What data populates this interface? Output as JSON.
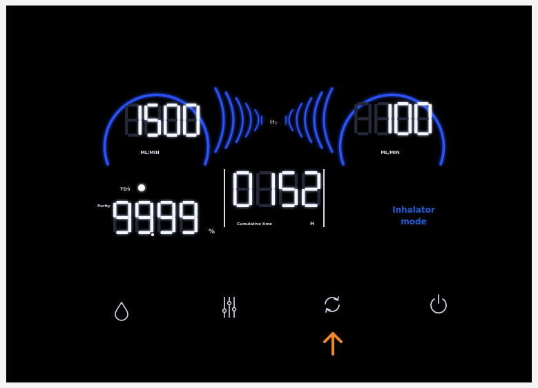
{
  "displays": {
    "left_flow": {
      "value": "1500",
      "unit": "ML/MIN"
    },
    "right_flow": {
      "value": "100",
      "unit": "ML/MIN"
    },
    "h2_label": "H₂",
    "purity": {
      "value": "99.99",
      "unit": "%",
      "label": "Purity"
    },
    "tds_label": "TDS",
    "hours": {
      "value": "0152",
      "label": "Cumulative time",
      "unit": "H"
    }
  },
  "mode": {
    "line1": "Inhalator",
    "line2": "mode"
  },
  "controls": [
    {
      "name": "water-drop-button",
      "icon": "water-drop-icon"
    },
    {
      "name": "settings-button",
      "icon": "sliders-icon"
    },
    {
      "name": "cycle-button",
      "icon": "refresh-icon"
    },
    {
      "name": "power-button",
      "icon": "power-icon"
    }
  ],
  "pointer": {
    "icon": "arrow-up-icon",
    "color": "#f08a24"
  },
  "colors": {
    "arc": "#2a52ff",
    "mode_text": "#1f5fd6",
    "segment_on": "#f5f7ff",
    "segment_off": "#242838",
    "background": "#000000"
  }
}
